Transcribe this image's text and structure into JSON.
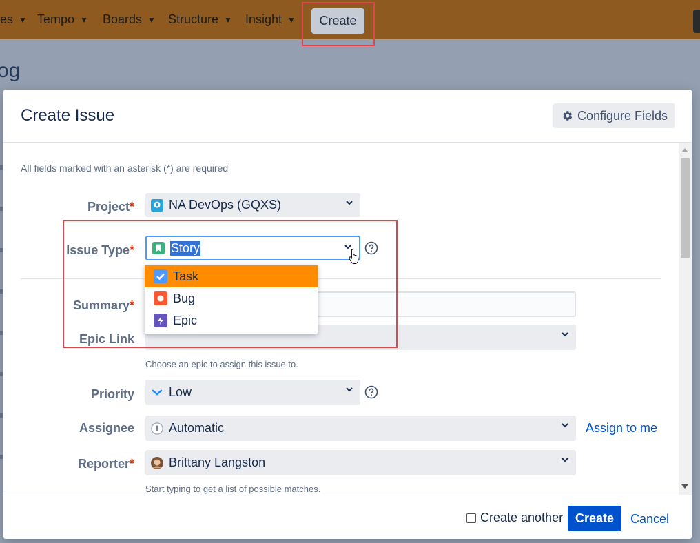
{
  "topnav": {
    "items": [
      {
        "label": "es"
      },
      {
        "label": "Tempo"
      },
      {
        "label": "Boards"
      },
      {
        "label": "Structure"
      },
      {
        "label": "Insight"
      }
    ],
    "create_label": "Create"
  },
  "background": {
    "title_fragment": "og"
  },
  "modal": {
    "title": "Create Issue",
    "configure_fields_label": "Configure Fields",
    "required_note": "All fields marked with an asterisk (*) are required",
    "fields": {
      "project": {
        "label": "Project",
        "value": "NA DevOps (GQXS)"
      },
      "issue_type": {
        "label": "Issue Type",
        "value": "Story"
      },
      "summary": {
        "label": "Summary",
        "value": ""
      },
      "epic_link": {
        "label": "Epic Link",
        "value": "",
        "hint": "Choose an epic to assign this issue to."
      },
      "priority": {
        "label": "Priority",
        "value": "Low"
      },
      "assignee": {
        "label": "Assignee",
        "value": "Automatic",
        "assign_to_me": "Assign to me"
      },
      "reporter": {
        "label": "Reporter",
        "value": "Brittany Langston",
        "hint": "Start typing to get a list of possible matches."
      }
    },
    "issue_type_options": [
      {
        "label": "Task",
        "icon": "task-icon",
        "color": "#4c9aff",
        "highlighted": true
      },
      {
        "label": "Bug",
        "icon": "bug-icon",
        "color": "#ff5630",
        "highlighted": false
      },
      {
        "label": "Epic",
        "icon": "epic-icon",
        "color": "#6554c0",
        "highlighted": false
      }
    ],
    "footer": {
      "create_another_label": "Create another",
      "create_another_checked": false,
      "create_label": "Create",
      "cancel_label": "Cancel"
    }
  },
  "colors": {
    "nav_bg": "#8f5a1f",
    "primary": "#0052cc",
    "highlight_box": "#e0474c",
    "dropdown_active": "#ff8b00"
  }
}
